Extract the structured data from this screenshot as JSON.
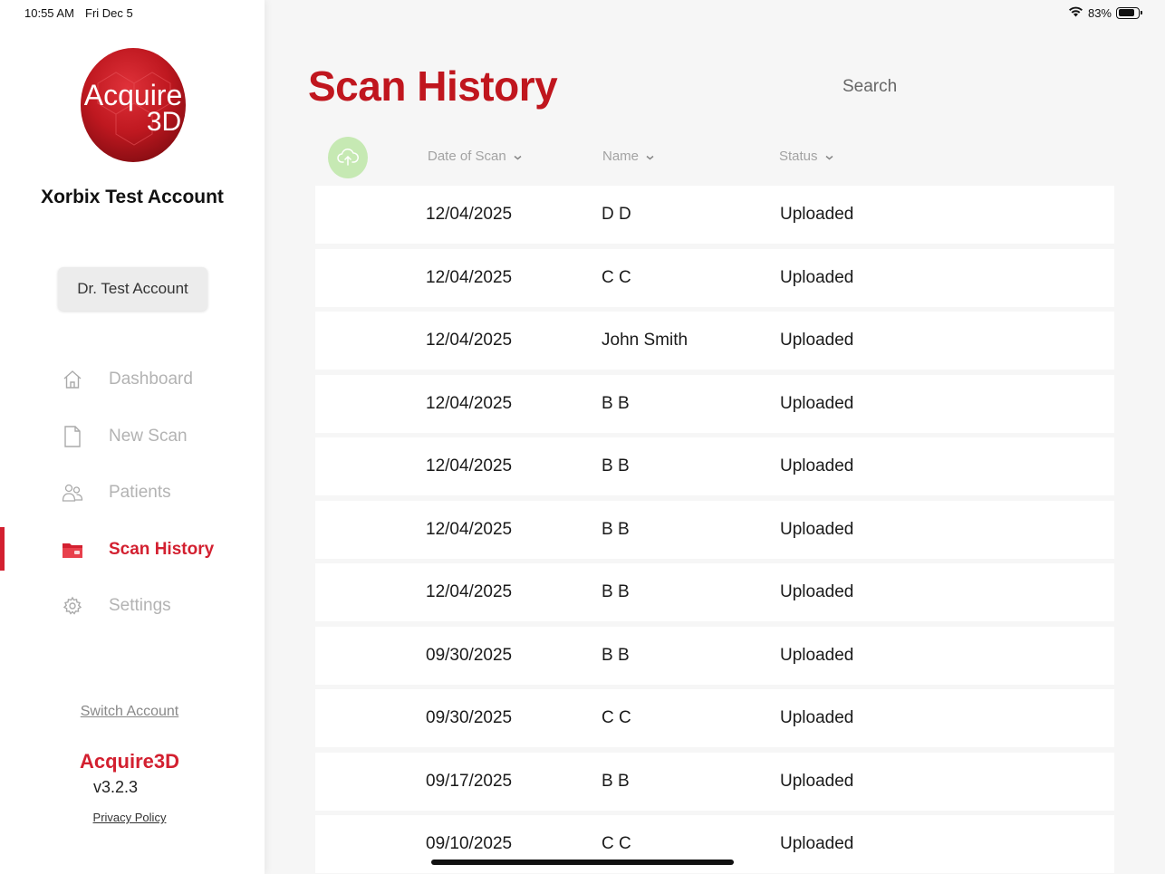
{
  "status_bar": {
    "time": "10:55 AM",
    "date": "Fri Dec 5",
    "battery": "83%",
    "battery_level": 0.83
  },
  "logo": {
    "text_line1": "Acquire",
    "text_line2": "3D",
    "color": "#c0161e"
  },
  "sidebar": {
    "account_name": "Xorbix Test Account",
    "doctor_label": "Dr. Test Account",
    "nav_items": [
      {
        "label": "Dashboard",
        "icon": "home-icon"
      },
      {
        "label": "New Scan",
        "icon": "document-icon"
      },
      {
        "label": "Patients",
        "icon": "people-icon"
      },
      {
        "label": "Scan History",
        "icon": "folder-icon",
        "active": true
      },
      {
        "label": "Settings",
        "icon": "gear-icon"
      }
    ],
    "switch_account": "Switch Account",
    "app_name": "Acquire3D",
    "version": "v3.2.3",
    "privacy_policy": "Privacy Policy"
  },
  "main": {
    "title": "Scan History",
    "search_placeholder": "Search",
    "upload_icon": "cloud-upload-icon",
    "columns": {
      "date": "Date of Scan",
      "name": "Name",
      "status": "Status"
    },
    "rows": [
      {
        "date": "12/04/2025",
        "name": "D D",
        "status": "Uploaded"
      },
      {
        "date": "12/04/2025",
        "name": "C C",
        "status": "Uploaded"
      },
      {
        "date": "12/04/2025",
        "name": "John Smith",
        "status": "Uploaded"
      },
      {
        "date": "12/04/2025",
        "name": "B B",
        "status": "Uploaded"
      },
      {
        "date": "12/04/2025",
        "name": "B B",
        "status": "Uploaded"
      },
      {
        "date": "12/04/2025",
        "name": "B B",
        "status": "Uploaded"
      },
      {
        "date": "12/04/2025",
        "name": "B B",
        "status": "Uploaded"
      },
      {
        "date": "09/30/2025",
        "name": "B B",
        "status": "Uploaded"
      },
      {
        "date": "09/30/2025",
        "name": "C C",
        "status": "Uploaded"
      },
      {
        "date": "09/17/2025",
        "name": "B B",
        "status": "Uploaded"
      },
      {
        "date": "09/10/2025",
        "name": "C C",
        "status": "Uploaded"
      }
    ]
  },
  "colors": {
    "accent": "#d32030",
    "upload_button": "#c6e9b3"
  }
}
